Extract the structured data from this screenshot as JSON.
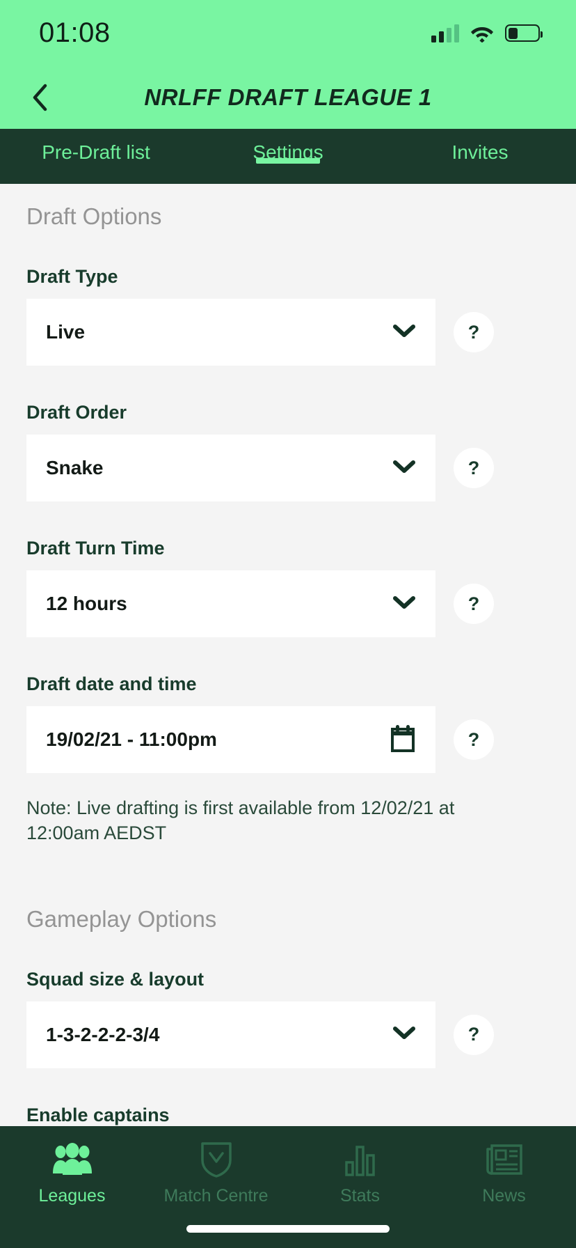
{
  "status_bar": {
    "time": "01:08",
    "signal_icon": "cellular-signal-icon",
    "wifi_icon": "wifi-icon",
    "battery_icon": "battery-icon"
  },
  "header": {
    "back_icon": "chevron-left-icon",
    "title": "NRLFF DRAFT LEAGUE 1",
    "background": "#79f5a2",
    "text_color": "#12291e"
  },
  "tabs": {
    "active": "Settings",
    "items": [
      {
        "label": "Pre-Draft list"
      },
      {
        "label": "Settings"
      },
      {
        "label": "Invites"
      }
    ],
    "background": "#1b3a2c",
    "text_color": "#6ef09a",
    "indicator_color": "#79f5a2"
  },
  "sections": [
    {
      "title": "Draft Options",
      "fields": [
        {
          "label": "Draft Type",
          "value": "Live",
          "control": "dropdown",
          "icon": "chevron-down-icon",
          "help_label": "?"
        },
        {
          "label": "Draft Order",
          "value": "Snake",
          "control": "dropdown",
          "icon": "chevron-down-icon",
          "help_label": "?"
        },
        {
          "label": "Draft Turn Time",
          "value": "12 hours",
          "control": "dropdown",
          "icon": "chevron-down-icon",
          "help_label": "?"
        },
        {
          "label": "Draft date and time",
          "value": "19/02/21 - 11:00pm",
          "control": "datepicker",
          "icon": "calendar-icon",
          "help_label": "?"
        }
      ],
      "note": "Note: Live drafting is first available from 12/02/21 at 12:00am AEDST"
    },
    {
      "title": "Gameplay Options",
      "fields": [
        {
          "label": "Squad size & layout",
          "value": "1-3-2-2-2-3/4",
          "control": "dropdown",
          "icon": "chevron-down-icon",
          "help_label": "?"
        },
        {
          "label": "Enable captains",
          "value": "",
          "control": "cut-off",
          "icon": "",
          "help_label": ""
        }
      ]
    }
  ],
  "bottom_nav": {
    "active": "Leagues",
    "items": [
      {
        "label": "Leagues",
        "icon": "people-group-icon"
      },
      {
        "label": "Match Centre",
        "icon": "shield-icon"
      },
      {
        "label": "Stats",
        "icon": "bar-chart-icon"
      },
      {
        "label": "News",
        "icon": "newspaper-icon"
      }
    ],
    "background": "#1b3a2c",
    "active_color": "#6ef09a",
    "inactive_color": "#3f7b5b"
  },
  "colors": {
    "brand_mint": "#79f5a2",
    "dark_green": "#1b3a2c",
    "page_bg": "#f4f4f4",
    "field_bg": "#ffffff",
    "label_color": "#183c2c",
    "section_title_color": "#949494"
  }
}
